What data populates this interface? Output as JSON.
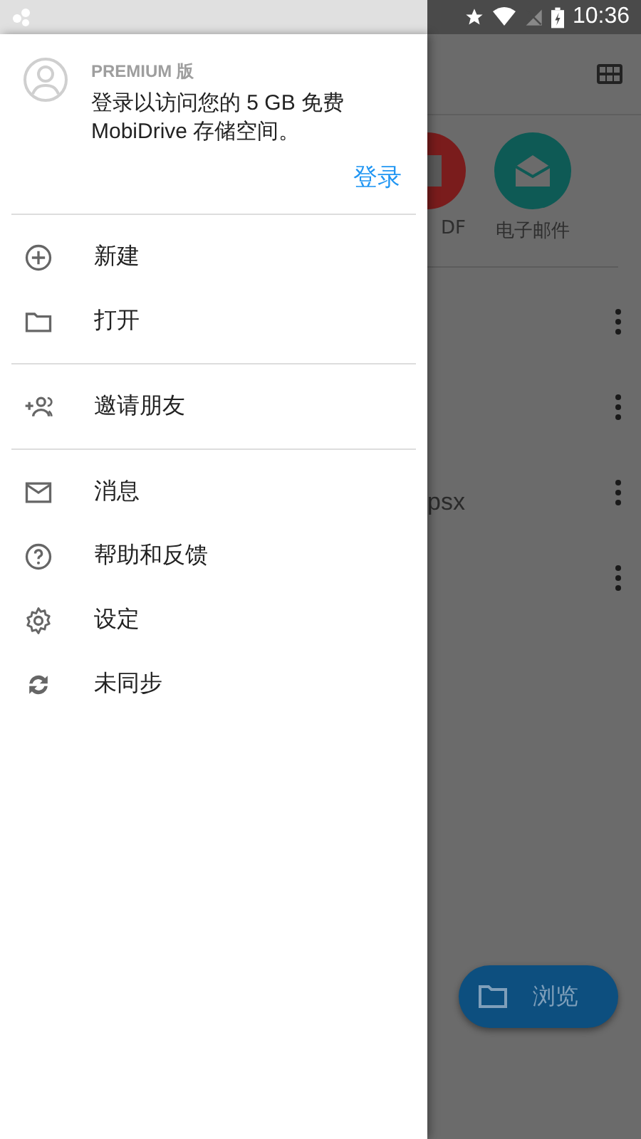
{
  "status_bar": {
    "time": "10:36"
  },
  "drawer": {
    "account": {
      "edition": "PREMIUM 版",
      "message": "登录以访问您的 5 GB 免费 MobiDrive 存储空间。",
      "login": "登录"
    },
    "sections": [
      [
        {
          "kind": "add",
          "label": "新建"
        },
        {
          "kind": "folder",
          "label": "打开"
        }
      ],
      [
        {
          "kind": "invite",
          "label": "邀请朋友"
        }
      ],
      [
        {
          "kind": "mail",
          "label": "消息"
        },
        {
          "kind": "help",
          "label": "帮助和反馈"
        },
        {
          "kind": "settings",
          "label": "设定"
        },
        {
          "kind": "sync",
          "label": "未同步"
        }
      ]
    ]
  },
  "background": {
    "shortcuts": [
      {
        "label": "DF",
        "color": "#7a1c1c"
      },
      {
        "label": "电子邮件",
        "color": "#0e5a55"
      }
    ],
    "files": [
      {
        "kind": "row"
      },
      {
        "kind": "row"
      },
      {
        "kind": "row",
        "name": "psx"
      },
      {
        "kind": "row"
      }
    ],
    "fab": {
      "label": "浏览"
    }
  }
}
